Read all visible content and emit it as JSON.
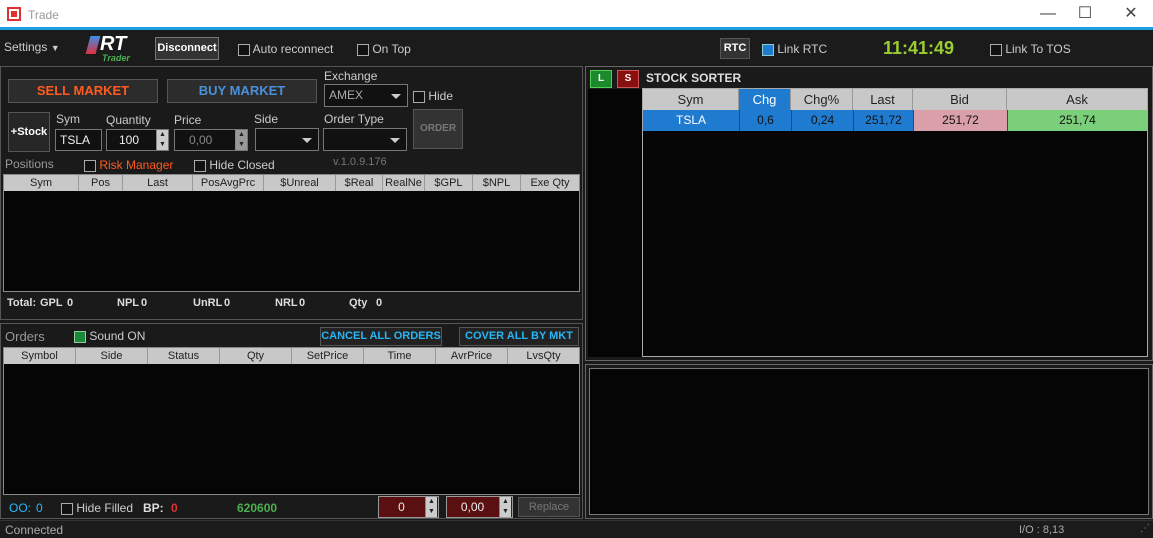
{
  "window": {
    "title": "Trade",
    "minimize": "—",
    "maximize": "☐",
    "close": "✕"
  },
  "toolbar": {
    "settings": "Settings",
    "logo_main": "RT",
    "logo_sub": "Trader",
    "disconnect": "Disconnect",
    "auto_reconnect": "Auto reconnect",
    "on_top": "On Top",
    "rtc": "RTC",
    "link_rtc": "Link RTC",
    "clock": "11:41:49",
    "link_tos": "Link To TOS"
  },
  "order_entry": {
    "sell_market": "SELL MARKET",
    "buy_market": "BUY MARKET",
    "exchange_label": "Exchange",
    "exchange_value": "AMEX",
    "hide": "Hide",
    "add_stock": "+Stock",
    "sym_label": "Sym",
    "sym_value": "TSLA",
    "quantity_label": "Quantity",
    "quantity_value": "100",
    "price_label": "Price",
    "price_value": "0,00",
    "side_label": "Side",
    "order_type_label": "Order Type",
    "order_button": "ORDER",
    "version": "v.1.0.9.176"
  },
  "positions": {
    "title": "Positions",
    "risk_manager": "Risk Manager",
    "hide_closed": "Hide Closed",
    "columns": [
      "Sym",
      "Pos",
      "Last",
      "PosAvgPrc",
      "$Unreal",
      "$Real",
      "RealNe",
      "$GPL",
      "$NPL",
      "Exe Qty"
    ],
    "totals": {
      "total_label": "Total:",
      "gpl_label": "GPL",
      "gpl": "0",
      "npl_label": "NPL",
      "npl": "0",
      "unrl_label": "UnRL",
      "unrl": "0",
      "nrl_label": "NRL",
      "nrl": "0",
      "qty_label": "Qty",
      "qty": "0"
    }
  },
  "orders": {
    "title": "Orders",
    "sound_on": "Sound ON",
    "cancel_all": "CANCEL ALL ORDERS",
    "cover_all": "COVER ALL BY MKT",
    "columns": [
      "Symbol",
      "Side",
      "Status",
      "Qty",
      "SetPrice",
      "Time",
      "AvrPrice",
      "LvsQty"
    ],
    "oo_label": "OO:",
    "oo_value": "0",
    "hide_filled": "Hide Filled",
    "bp_label": "BP:",
    "bp_value": "0",
    "bp_total": "620600",
    "replace_qty": "0",
    "replace_price": "0,00",
    "replace_button": "Replace"
  },
  "sorter": {
    "long_button": "L",
    "short_button": "S",
    "title": "STOCK SORTER",
    "columns": [
      "Sym",
      "Chg",
      "Chg%",
      "Last",
      "Bid",
      "Ask"
    ],
    "rows": [
      {
        "sym": "TSLA",
        "chg": "0,6",
        "chg_pct": "0,24",
        "last": "251,72",
        "bid": "251,72",
        "ask": "251,74"
      }
    ]
  },
  "status": {
    "text": "Connected",
    "io": "I/O : 8,13"
  },
  "colors": {
    "accent": "#1ba1e2",
    "sell": "#ff5a1f",
    "buy": "#4a90d9",
    "bid_bg": "#d9a0aa",
    "ask_bg": "#7ccf7a",
    "clock": "#9acd32"
  }
}
